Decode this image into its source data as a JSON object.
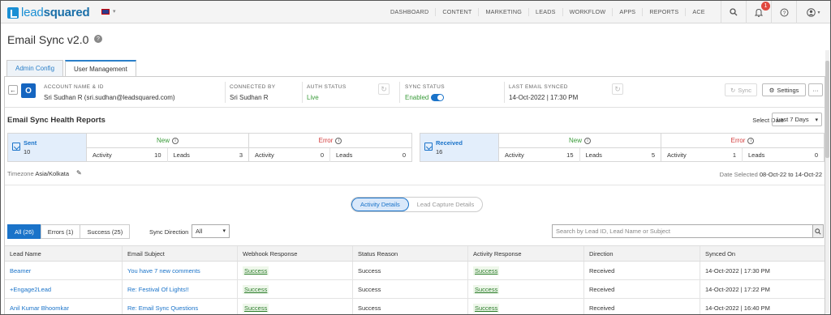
{
  "brand": {
    "logo_lead": "lead",
    "logo_squared": "squared"
  },
  "nav": {
    "items": [
      "DASHBOARD",
      "CONTENT",
      "MARKETING",
      "LEADS",
      "WORKFLOW",
      "APPS",
      "REPORTS",
      "ACE"
    ],
    "notification_count": "1"
  },
  "page": {
    "title": "Email Sync v2.0"
  },
  "tabs": [
    "Admin Config",
    "User Management"
  ],
  "account": {
    "name_label": "ACCOUNT NAME & ID",
    "name_value": "Sri Sudhan R (sri.sudhan@leadsquared.com)",
    "connected_label": "CONNECTED BY",
    "connected_value": "Sri Sudhan R",
    "auth_label": "AUTH STATUS",
    "auth_value": "Live",
    "sync_label": "SYNC STATUS",
    "sync_value": "Enabled",
    "last_label": "LAST EMAIL SYNCED",
    "last_value": "14-Oct-2022 | 17:30 PM",
    "sync_btn": "Sync",
    "settings_btn": "Settings"
  },
  "health": {
    "title": "Email Sync Health Reports",
    "select_date_label": "Select Date",
    "select_date_value": "Last 7 Days",
    "sent": {
      "label": "Sent",
      "count": "10",
      "new_label": "New",
      "error_label": "Error",
      "new_activity": "10",
      "new_leads": "3",
      "err_activity": "0",
      "err_leads": "0"
    },
    "received": {
      "label": "Received",
      "count": "16",
      "new_label": "New",
      "error_label": "Error",
      "new_activity": "15",
      "new_leads": "5",
      "err_activity": "1",
      "err_leads": "0"
    },
    "activity_label": "Activity",
    "leads_label": "Leads",
    "timezone_label": "Timezone",
    "timezone_value": "Asia/Kolkata",
    "date_selected_label": "Date Selected",
    "date_selected_value": "08-Oct-22 to 14-Oct-22"
  },
  "details": {
    "activity": "Activity Details",
    "lead_capture": "Lead Capture Details"
  },
  "filters": {
    "all": "All (26)",
    "errors": "Errors (1)",
    "success": "Success (25)",
    "sync_direction_label": "Sync Direction",
    "sync_direction_value": "All",
    "search_placeholder": "Search by Lead ID, Lead Name or Subject"
  },
  "table": {
    "headers": [
      "Lead Name",
      "Email Subject",
      "Webhook Response",
      "Status Reason",
      "Activity Response",
      "Direction",
      "Synced On"
    ],
    "rows": [
      [
        "Beamer",
        "You have 7 new comments",
        "Success",
        "Success",
        "Success",
        "Received",
        "14-Oct-2022 | 17:30 PM"
      ],
      [
        "+Engage2Lead",
        "Re: Festival Of Lights!!",
        "Success",
        "Success",
        "Success",
        "Received",
        "14-Oct-2022 | 17:22 PM"
      ],
      [
        "Anil Kumar Bhoomkar",
        "Re: Email Sync Questions",
        "Success",
        "Success",
        "Success",
        "Received",
        "14-Oct-2022 | 16:40 PM"
      ]
    ]
  }
}
